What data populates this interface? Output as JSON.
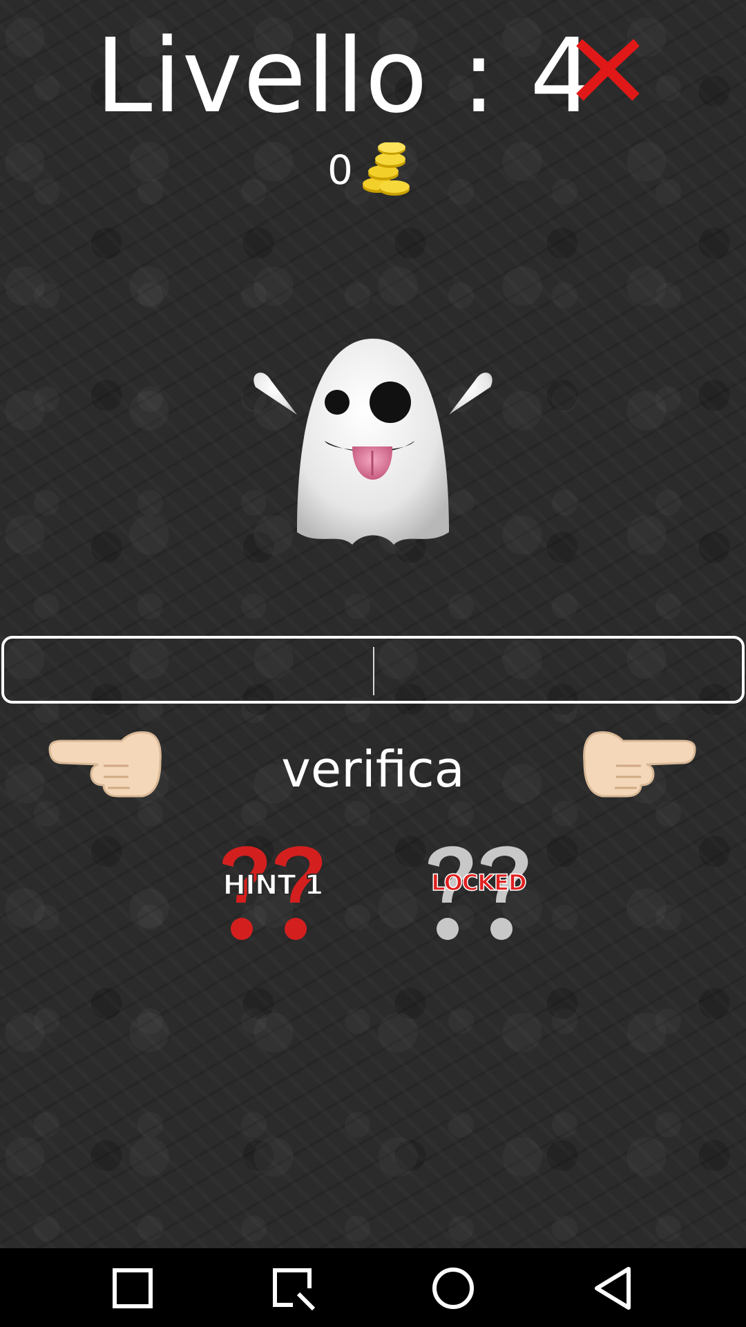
{
  "header": {
    "level_label": "Livello : 4",
    "coins": "0"
  },
  "icons": {
    "close": "close-x-icon",
    "coins": "gold-coins-icon",
    "puzzle": "ghost-emoji",
    "hand_left": "pointing-left-hand-icon",
    "hand_right": "pointing-right-hand-icon"
  },
  "answer": {
    "value": "",
    "placeholder": ""
  },
  "actions": {
    "verify_label": "verifica"
  },
  "hints": [
    {
      "label": "HINT 1",
      "color": "#e02020",
      "state": "available"
    },
    {
      "label": "LOCKED",
      "color": "#cfcfcf",
      "state": "locked"
    }
  ],
  "navbar": {
    "buttons": [
      "recents-square",
      "screenshot",
      "home-circle",
      "back-triangle"
    ]
  },
  "colors": {
    "background": "#2b2b2b",
    "close_red": "#e01818",
    "hint_red": "#d41f1f",
    "locked_grey": "#c8c8c8"
  }
}
